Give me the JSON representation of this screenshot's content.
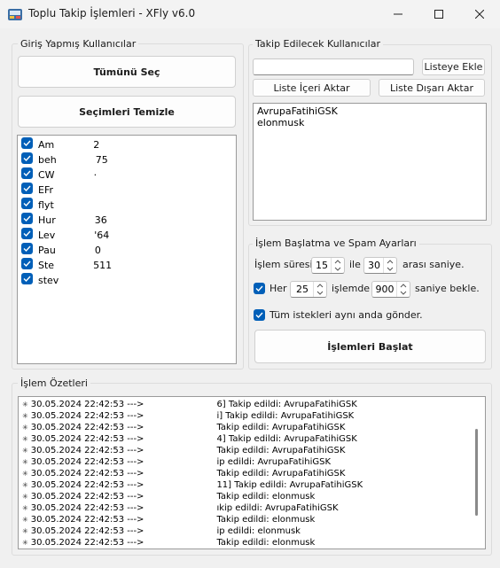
{
  "window": {
    "title": "Toplu Takip İşlemleri - XFly v6.0",
    "minimize_icon": "minimize-icon",
    "maximize_icon": "maximize-icon",
    "close_icon": "close-icon"
  },
  "logged_in": {
    "group_label": "Giriş Yapmış Kullanıcılar",
    "select_all_label": "Tümünü Seç",
    "clear_selection_label": "Seçimleri Temizle",
    "users": [
      {
        "visible": "Am",
        "tail": "2",
        "checked": true
      },
      {
        "visible": "beh",
        "tail": "75",
        "checked": true
      },
      {
        "visible": "CW",
        "tail": "·",
        "checked": true
      },
      {
        "visible": "EFr",
        "tail": "",
        "checked": true
      },
      {
        "visible": "flyt",
        "tail": "",
        "checked": true
      },
      {
        "visible": "Hur",
        "tail": "36",
        "checked": true
      },
      {
        "visible": "Lev",
        "tail": "'64",
        "checked": true
      },
      {
        "visible": "Pau",
        "tail": "0",
        "checked": true
      },
      {
        "visible": "Ste",
        "tail": "511",
        "checked": true
      },
      {
        "visible": "stev",
        "tail": "",
        "checked": true
      }
    ]
  },
  "targets": {
    "group_label": "Takip Edilecek Kullanıcılar",
    "input_value": "",
    "add_to_list_label": "Listeye Ekle",
    "import_label": "Liste İçeri Aktar",
    "export_label": "Liste Dışarı Aktar",
    "list": [
      "AvrupaFatihiGSK",
      "elonmusk"
    ]
  },
  "settings": {
    "group_label": "İşlem Başlatma ve Spam Ayarları",
    "duration_label": "İşlem süresi",
    "duration_min": "15",
    "between_label": "ile",
    "duration_max": "30",
    "seconds_between_label": "arası saniye.",
    "every_checked": true,
    "every_label": "Her",
    "every_count": "25",
    "every_unit_label": "işlemde",
    "wait_seconds": "900",
    "wait_label": "saniye bekle.",
    "send_all_checked": true,
    "send_all_label": "Tüm istekleri aynı anda gönder.",
    "start_label": "İşlemleri Başlat"
  },
  "log": {
    "group_label": "İşlem Özetleri",
    "lines": [
      {
        "time": "30.05.2024 22:42:53 --->",
        "msg": "6] Takip edildi: AvrupaFatihiGSK"
      },
      {
        "time": "30.05.2024 22:42:53 --->",
        "msg": "i] Takip edildi: AvrupaFatihiGSK"
      },
      {
        "time": "30.05.2024 22:42:53 --->",
        "msg": "Takip edildi: AvrupaFatihiGSK"
      },
      {
        "time": "30.05.2024 22:42:53 --->",
        "msg": "4] Takip edildi: AvrupaFatihiGSK"
      },
      {
        "time": "30.05.2024 22:42:53 --->",
        "msg": "Takip edildi: AvrupaFatihiGSK"
      },
      {
        "time": "30.05.2024 22:42:53 --->",
        "msg": "ip edildi: AvrupaFatihiGSK"
      },
      {
        "time": "30.05.2024 22:42:53 --->",
        "msg": "Takip edildi: AvrupaFatihiGSK"
      },
      {
        "time": "30.05.2024 22:42:53 --->",
        "msg": "11] Takip edildi: AvrupaFatihiGSK"
      },
      {
        "time": "30.05.2024 22:42:53 --->",
        "msg": "Takip edildi: elonmusk"
      },
      {
        "time": "30.05.2024 22:42:53 --->",
        "msg": "ıkip edildi: AvrupaFatihiGSK"
      },
      {
        "time": "30.05.2024 22:42:53 --->",
        "msg": "Takip edildi: elonmusk"
      },
      {
        "time": "30.05.2024 22:42:53 --->",
        "msg": "ip edildi: elonmusk"
      },
      {
        "time": "30.05.2024 22:42:53 --->",
        "msg": "Takip edildi: elonmusk"
      }
    ]
  },
  "colors": {
    "checkbox_accent": "#005fb8",
    "window_bg": "#f0f0f0"
  }
}
